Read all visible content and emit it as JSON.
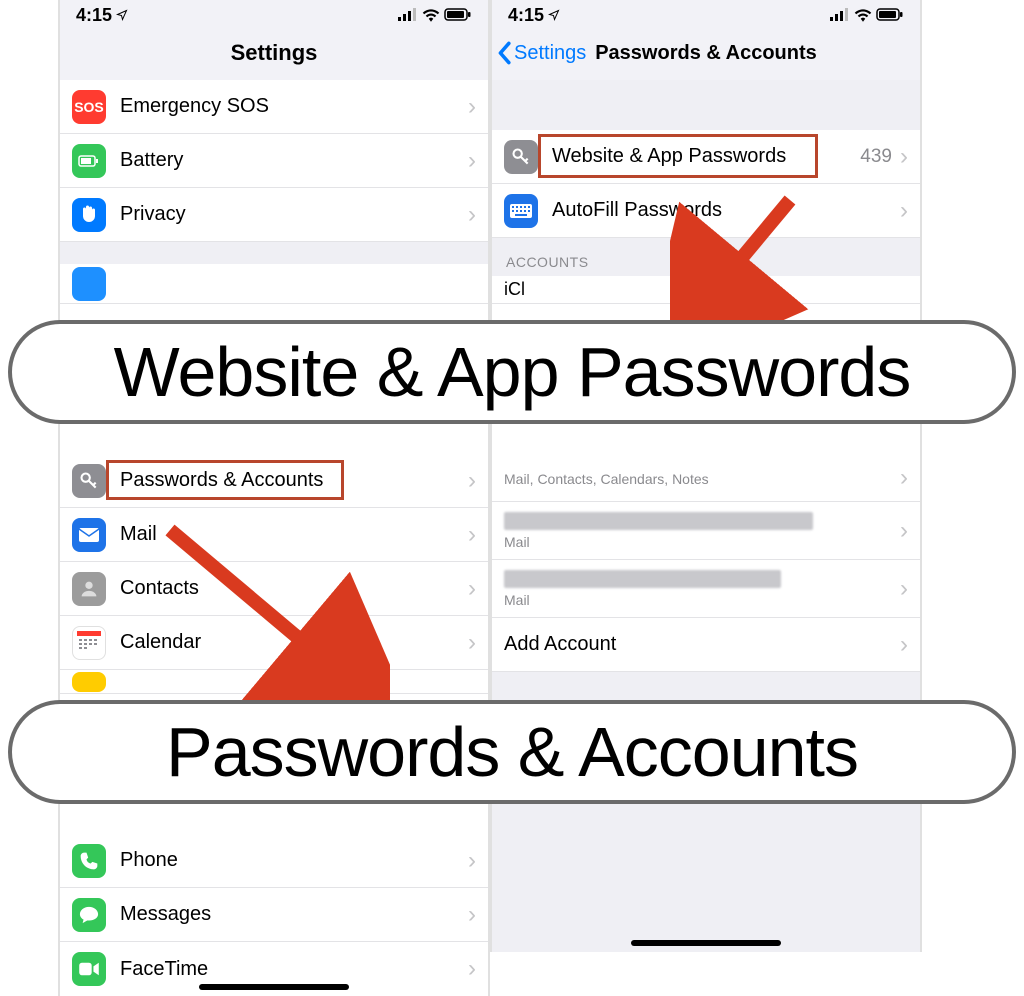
{
  "status": {
    "time": "4:15"
  },
  "left": {
    "title": "Settings",
    "rows": {
      "sos": "Emergency SOS",
      "battery": "Battery",
      "privacy": "Privacy",
      "passwords_accounts": "Passwords & Accounts",
      "mail": "Mail",
      "contacts": "Contacts",
      "calendar": "Calendar",
      "phone": "Phone",
      "messages": "Messages",
      "facetime": "FaceTime"
    }
  },
  "right": {
    "back": "Settings",
    "title": "Passwords & Accounts",
    "website_app_passwords": "Website & App Passwords",
    "website_app_passwords_count": "439",
    "autofill": "AutoFill Passwords",
    "accounts_header": "Accounts",
    "account_detail_full": "Mail, Contacts, Calendars, Notes",
    "account_detail_mail": "Mail",
    "add_account": "Add Account"
  },
  "callouts": {
    "top": "Website & App Passwords",
    "bottom": "Passwords & Accounts"
  }
}
